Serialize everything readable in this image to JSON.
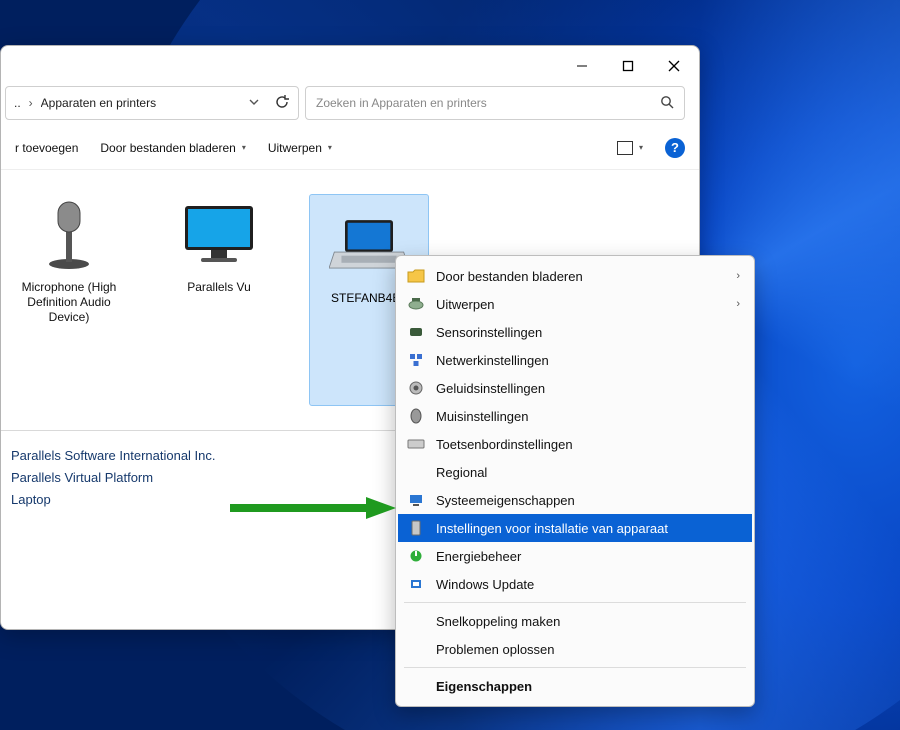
{
  "titlebar": {
    "min": "Minimize",
    "max": "Maximize",
    "close": "Close"
  },
  "address": {
    "path_prefix": "..",
    "path_sep": "›",
    "path_text": "Apparaten en printers",
    "refresh": "Refresh"
  },
  "search": {
    "placeholder": "Zoeken in Apparaten en printers"
  },
  "toolbar": {
    "add": "r toevoegen",
    "browse": "Door bestanden bladeren",
    "eject": "Uitwerpen",
    "view": "View",
    "help": "?"
  },
  "devices": [
    {
      "caption": "Microphone\n(High Definition Audio Device)",
      "selected": false,
      "icon": "microphone"
    },
    {
      "caption": "Parallels Vu",
      "selected": false,
      "icon": "monitor"
    },
    {
      "caption": "STEFANB4E0",
      "selected": true,
      "icon": "laptop"
    }
  ],
  "details": {
    "line1": "Parallels Software International Inc.",
    "line2": "Parallels Virtual Platform",
    "line3": "Laptop"
  },
  "context_menu": {
    "items": [
      {
        "label": "Door bestanden bladeren",
        "icon": "folder",
        "submenu": true
      },
      {
        "label": "Uitwerpen",
        "icon": "eject",
        "submenu": true
      },
      {
        "label": "Sensorinstellingen",
        "icon": "sensor"
      },
      {
        "label": "Netwerkinstellingen",
        "icon": "network"
      },
      {
        "label": "Geluidsinstellingen",
        "icon": "sound"
      },
      {
        "label": "Muisinstellingen",
        "icon": "mouse"
      },
      {
        "label": "Toetsenbordinstellingen",
        "icon": "keyboard"
      },
      {
        "label": "Regional",
        "icon": ""
      },
      {
        "label": "Systeemeigenschappen",
        "icon": "system"
      },
      {
        "label": "Instellingen voor installatie van apparaat",
        "icon": "device",
        "highlight": true
      },
      {
        "label": "Energiebeheer",
        "icon": "power"
      },
      {
        "label": "Windows Update",
        "icon": "update"
      }
    ],
    "after_items": [
      {
        "label": "Snelkoppeling maken"
      },
      {
        "label": "Problemen oplossen"
      }
    ],
    "properties": "Eigenschappen"
  }
}
